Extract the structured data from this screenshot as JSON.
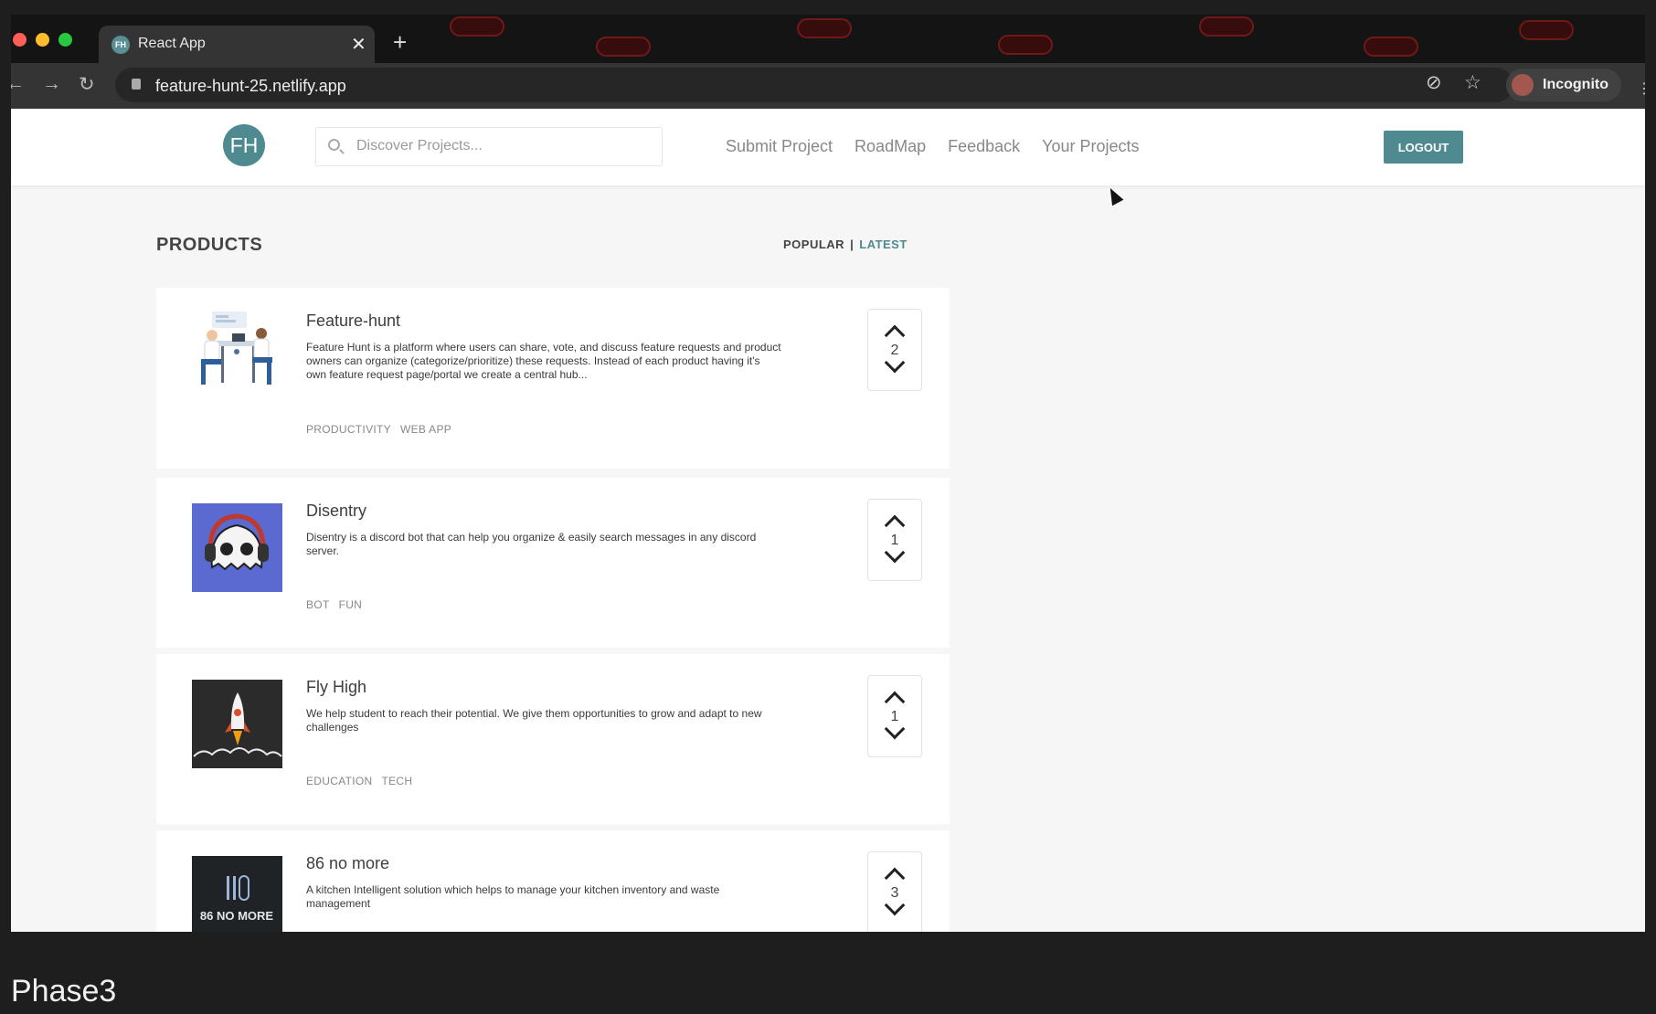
{
  "browser": {
    "tab_title": "React App",
    "tab_favicon": "FH",
    "tab_close": "✕",
    "new_tab": "+",
    "url": "feature-hunt-25.netlify.app",
    "profile_label": "Incognito"
  },
  "app": {
    "logo_text": "FH",
    "search_placeholder": "Discover Projects...",
    "nav": [
      "Submit Project",
      "RoadMap",
      "Feedback",
      "Your Projects"
    ],
    "logout_label": "LOGOUT",
    "accent_color": "#4e8a8f"
  },
  "products": {
    "heading": "PRODUCTS",
    "sort_popular": "POPULAR",
    "sort_separator": "|",
    "sort_latest": "LATEST",
    "active_sort": "LATEST",
    "items": [
      {
        "name": "Feature-hunt",
        "description": "Feature Hunt is a platform where users can share, vote, and discuss feature requests and product owners can organize (categorize/prioritize) these requests. Instead of each product having it's own feature request page/portal we create a central hub...",
        "tags": [
          "PRODUCTIVITY",
          "WEB APP"
        ],
        "votes": "2",
        "thumb_icon": "people-meeting-illustration"
      },
      {
        "name": "Disentry",
        "description": "Disentry is a discord bot that can help you organize & easily search messages in any discord server.",
        "tags": [
          "BOT",
          "FUN"
        ],
        "votes": "1",
        "thumb_icon": "ghost-headphones-logo"
      },
      {
        "name": "Fly High",
        "description": "We help student to reach their potential. We give them opportunities to grow and adapt to new challenges",
        "tags": [
          "EDUCATION",
          "TECH"
        ],
        "votes": "1",
        "thumb_icon": "rocket-logo"
      },
      {
        "name": "86 no more",
        "description": "A kitchen Intelligent solution which helps to manage your kitchen inventory and waste management",
        "tags": [],
        "votes": "3",
        "thumb_icon": "86-no-more-logo",
        "thumb_text": "86 NO MORE"
      }
    ]
  },
  "caption": "Phase3"
}
